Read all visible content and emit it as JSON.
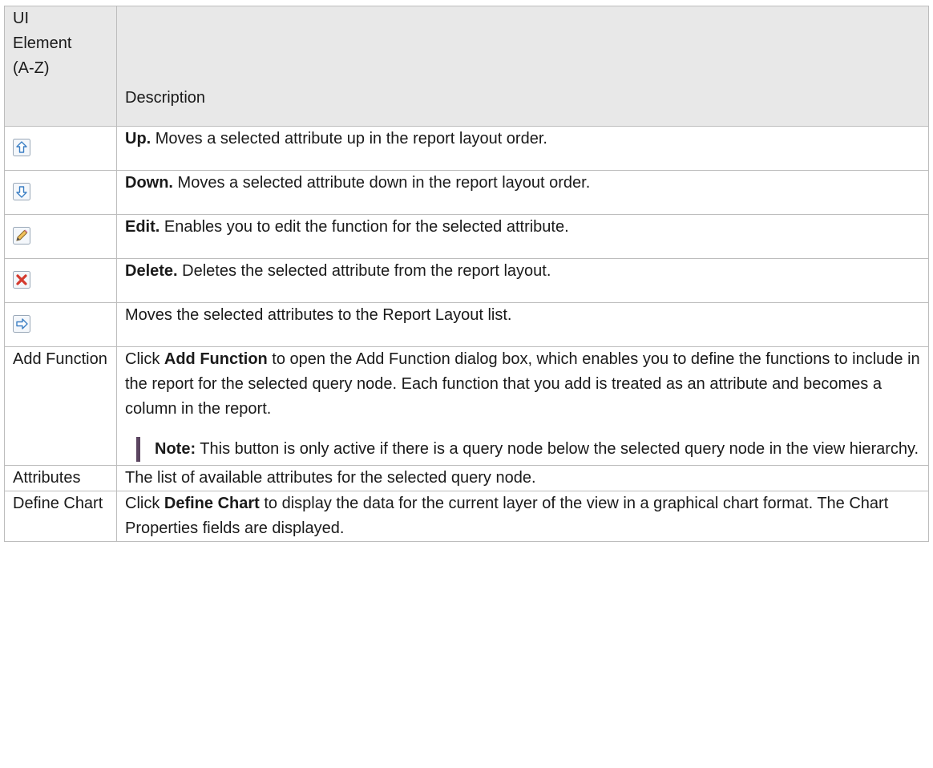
{
  "header": {
    "col1": "UI Element (A-Z)",
    "col1_lines": [
      "UI",
      "Element",
      "(A-Z)"
    ],
    "col2": "Description"
  },
  "rows": [
    {
      "icon": "up-arrow-icon",
      "bold": "Up.",
      "text": " Moves a selected attribute up in the report layout order."
    },
    {
      "icon": "down-arrow-icon",
      "bold": "Down.",
      "text": " Moves a selected attribute down in the report layout order."
    },
    {
      "icon": "pencil-icon",
      "bold": "Edit.",
      "text": " Enables you to edit the function for the selected attribute."
    },
    {
      "icon": "delete-x-icon",
      "bold": "Delete.",
      "text": " Deletes the selected attribute from the report layout."
    },
    {
      "icon": "right-arrow-icon",
      "bold": "",
      "text": "Moves the selected attributes to the Report Layout list."
    }
  ],
  "add_function": {
    "label": "Add Function",
    "pre": "Click ",
    "bold": "Add Function",
    "post": " to open the Add Function dialog box, which enables you to define the functions to include in the report for the selected query node. Each function that you add is treated as an attribute and becomes a column in the report.",
    "note_label": "Note:",
    "note_text": " This button is only active if there is a query node below the selected query node in the view hierarchy."
  },
  "attributes": {
    "label": "Attributes",
    "text": "The list of available attributes for the selected query node."
  },
  "define_chart": {
    "label": "Define Chart",
    "pre": "Click ",
    "bold": "Define Chart",
    "post": " to display the data for the current layer of the view in a graphical chart format. The Chart Properties fields are displayed."
  }
}
